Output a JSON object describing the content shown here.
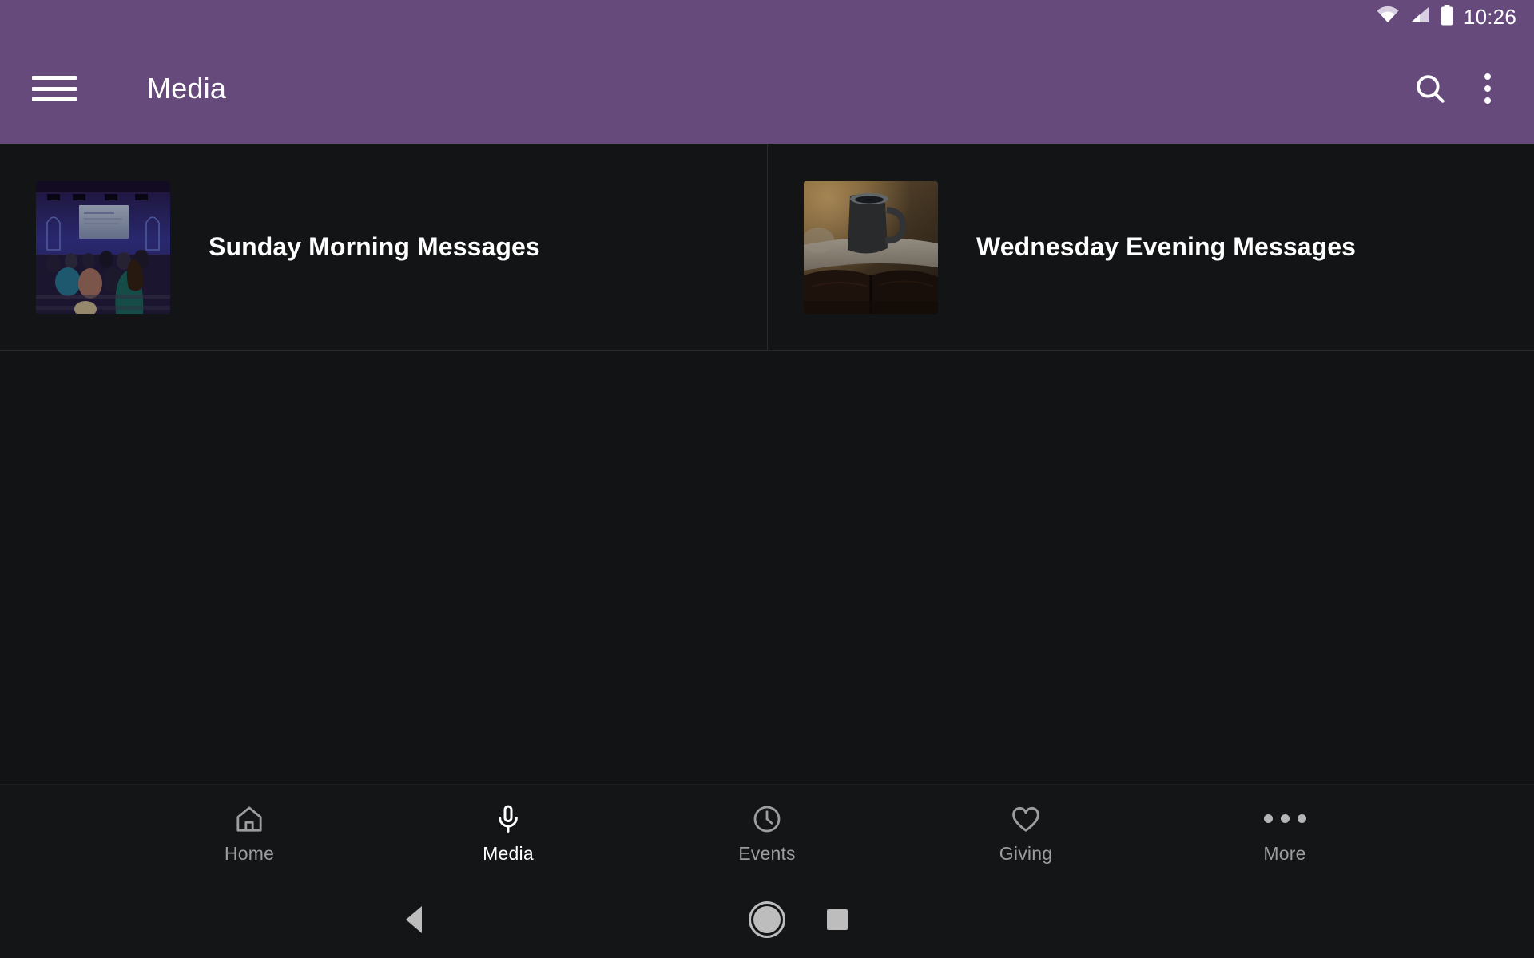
{
  "status_bar": {
    "time": "10:26",
    "icons": [
      "wifi-icon",
      "cellular-signal-icon",
      "battery-icon"
    ]
  },
  "app_bar": {
    "title": "Media",
    "menu_icon": "hamburger-menu-icon",
    "search_icon": "search-icon",
    "overflow_icon": "overflow-menu-icon",
    "background_color": "#654a7b"
  },
  "media": {
    "cards": [
      {
        "title": "Sunday Morning Messages",
        "thumbnail": "church-sanctuary-congregation-thumbnail"
      },
      {
        "title": "Wednesday Evening Messages",
        "thumbnail": "coffee-mug-open-bible-thumbnail"
      }
    ]
  },
  "tab_bar": {
    "active_index": 1,
    "items": [
      {
        "label": "Home",
        "icon": "home-icon"
      },
      {
        "label": "Media",
        "icon": "microphone-icon"
      },
      {
        "label": "Events",
        "icon": "clock-icon"
      },
      {
        "label": "Giving",
        "icon": "heart-icon"
      },
      {
        "label": "More",
        "icon": "more-horizontal-icon"
      }
    ]
  },
  "system_nav": {
    "back": "back-triangle-icon",
    "home": "home-circle-icon",
    "recents": "recents-square-icon"
  },
  "colors": {
    "accent_purple": "#654a7b",
    "background": "#121314",
    "tab_inactive": "#9d9d9d",
    "tab_active": "#ffffff"
  }
}
